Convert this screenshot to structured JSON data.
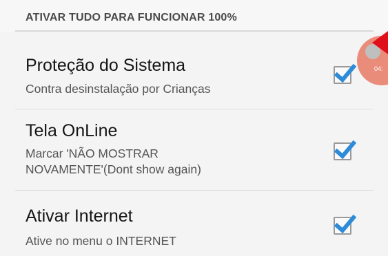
{
  "section": {
    "header": "ATIVAR TUDO PARA FUNCIONAR 100%"
  },
  "items": [
    {
      "title": "Proteção do Sistema",
      "summary_lines": [
        "Contra desinstalação por Crianças"
      ],
      "checked": true
    },
    {
      "title": "Tela OnLine",
      "summary_lines": [
        "Marcar 'NÃO MOSTRAR",
        "NOVAMENTE'(Dont show again)"
      ],
      "checked": true
    },
    {
      "title": "Ativar Internet",
      "summary_lines": [
        "Ative no menu o INTERNET"
      ],
      "checked": true
    }
  ],
  "overlay_bubble": {
    "label": "04:"
  },
  "colors": {
    "check_accent": "#2e8bd8",
    "bubble": "#e8826f",
    "arrow": "#e0101a"
  }
}
